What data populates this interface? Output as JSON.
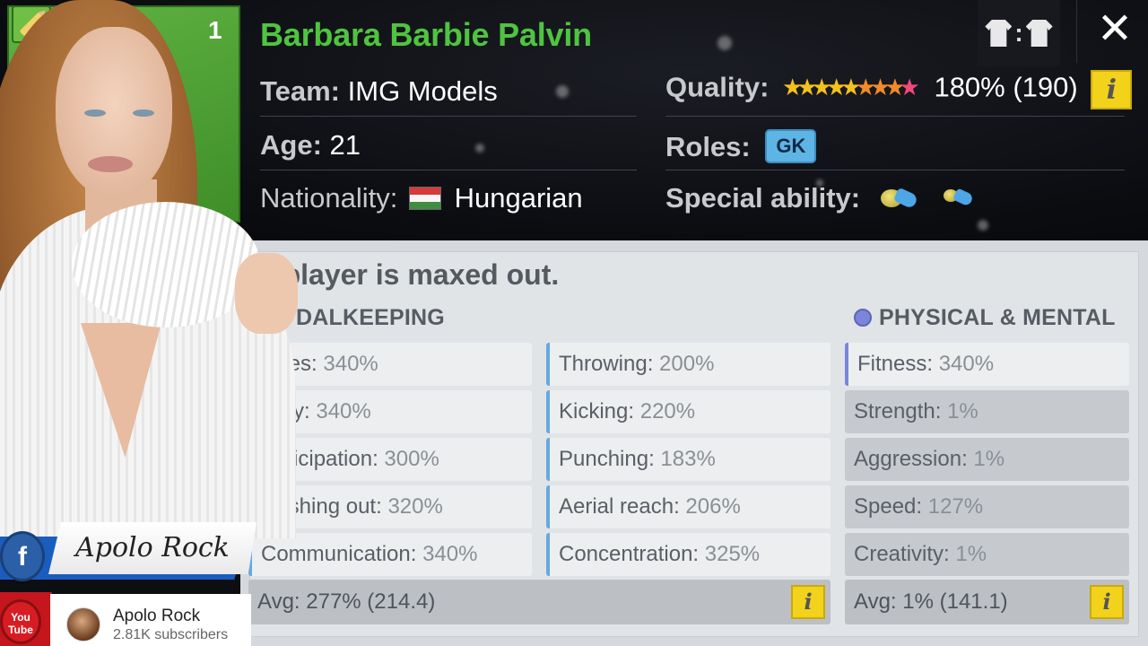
{
  "header": {
    "card_number": "1",
    "player_name": "Barbara Barbie Palvin",
    "team_label": "Team:",
    "team_value": "IMG Models",
    "age_label": "Age:",
    "age_value": "21",
    "nationality_label": "Nationality:",
    "nationality_value": "Hungarian",
    "quality_label": "Quality:",
    "quality_value": "180% (190)",
    "quality_stars": 9,
    "roles_label": "Roles:",
    "role_badge": "GK",
    "special_ability_label": "Special ability:",
    "info_glyph": "i"
  },
  "panel": {
    "maxed_message": "is player is maxed out.",
    "goalkeeping_title": "DALKEEPING",
    "physical_title": "PHYSICAL & MENTAL",
    "goalkeeping_stats": [
      {
        "label": "lexes:",
        "value": "340%"
      },
      {
        "label": "gility:",
        "value": "340%"
      },
      {
        "label": "Anticipation:",
        "value": "300%"
      },
      {
        "label": "Rushing out:",
        "value": "320%"
      },
      {
        "label": "Communication:",
        "value": "340%"
      }
    ],
    "goalkeeping_stats_col2": [
      {
        "label": "Throwing:",
        "value": "200%"
      },
      {
        "label": "Kicking:",
        "value": "220%"
      },
      {
        "label": "Punching:",
        "value": "183%"
      },
      {
        "label": "Aerial reach:",
        "value": "206%"
      },
      {
        "label": "Concentration:",
        "value": "325%"
      }
    ],
    "physical_stats": [
      {
        "label": "Fitness:",
        "value": "340%"
      },
      {
        "label": "Strength:",
        "value": "1%"
      },
      {
        "label": "Aggression:",
        "value": "1%"
      },
      {
        "label": "Speed:",
        "value": "127%"
      },
      {
        "label": "Creativity:",
        "value": "1%"
      }
    ],
    "goalkeeping_avg": "Avg: 277% (214.4)",
    "physical_avg": "Avg: 1% (141.1)"
  },
  "overlay": {
    "signature": "Apolo Rock",
    "facebook_glyph": "f",
    "youtube_logo_text": "You Tube",
    "channel_name": "Apolo Rock",
    "subscribers": "2.81K subscribers"
  },
  "colors": {
    "name_green": "#4fc440",
    "info_yellow": "#f2d21b",
    "role_blue": "#5fb4e6",
    "physical_dot": "#7b85d9"
  },
  "icons": [
    "pencil-icon",
    "shirt-icon",
    "close-icon",
    "hungary-flag-icon",
    "star-icon",
    "ability-icon",
    "facebook-icon",
    "youtube-icon"
  ]
}
